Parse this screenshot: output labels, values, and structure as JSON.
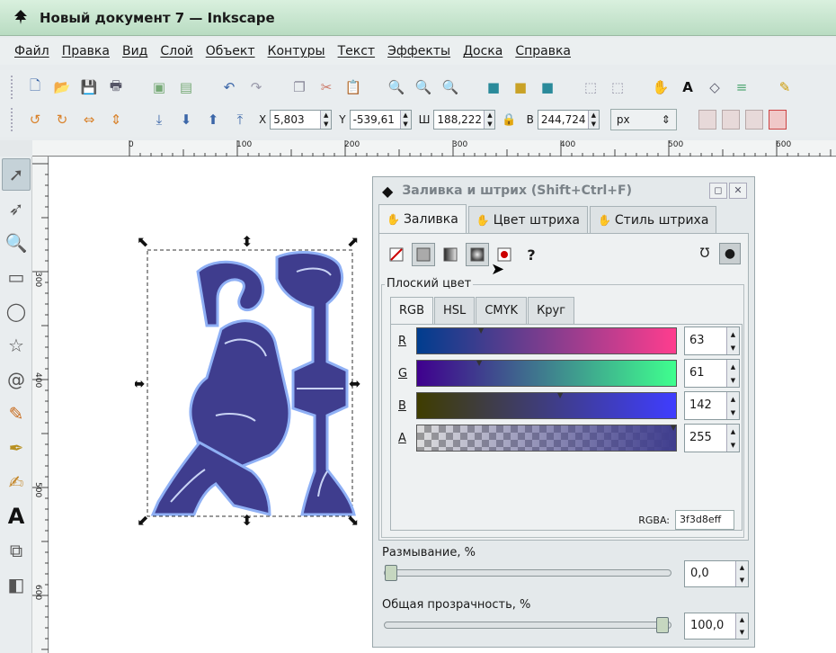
{
  "window": {
    "title": "Новый документ 7 — Inkscape"
  },
  "menu": [
    "Файл",
    "Правка",
    "Вид",
    "Слой",
    "Объект",
    "Контуры",
    "Текст",
    "Эффекты",
    "Доска",
    "Справка"
  ],
  "coords": {
    "x_label": "X",
    "x_value": "5,803",
    "y_label": "Y",
    "y_value": "-539,61",
    "w_label": "Ш",
    "w_value": "188,222",
    "h_label": "В",
    "h_value": "244,724",
    "unit": "px"
  },
  "ruler": {
    "labels": [
      "0",
      "100",
      "200",
      "300",
      "400",
      "500",
      "600"
    ],
    "left_labels": [
      "300",
      "400",
      "500",
      "600"
    ]
  },
  "dialog": {
    "title": "Заливка и штрих (Shift+Ctrl+F)",
    "tabs": [
      "Заливка",
      "Цвет штриха",
      "Стиль штриха"
    ],
    "help_glyph": "?",
    "section_label": "Плоский цвет",
    "color_tabs": [
      "RGB",
      "HSL",
      "CMYK",
      "Круг"
    ],
    "channels": [
      {
        "label": "R",
        "value": "63"
      },
      {
        "label": "G",
        "value": "61"
      },
      {
        "label": "B",
        "value": "142"
      },
      {
        "label": "A",
        "value": "255"
      }
    ],
    "rgba_label": "RGBA:",
    "rgba_value": "3f3d8eff",
    "blur_label": "Размывание, %",
    "blur_value": "0,0",
    "blur_level": 0,
    "opacity_label": "Общая прозрачность, %",
    "opacity_value": "100,0",
    "opacity_level": 100
  },
  "colors": {
    "fill": "#3f3d8e",
    "stroke": "#6a8fe0"
  }
}
